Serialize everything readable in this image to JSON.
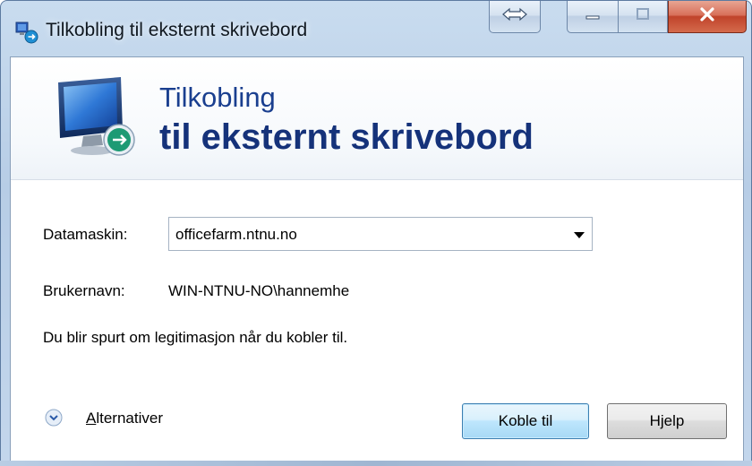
{
  "window": {
    "title": "Tilkobling til eksternt skrivebord"
  },
  "banner": {
    "line1": "Tilkobling",
    "line2": "til eksternt skrivebord"
  },
  "form": {
    "computer_label": "Datamaskin:",
    "computer_value": "officefarm.ntnu.no",
    "username_label": "Brukernavn:",
    "username_value": "WIN-NTNU-NO\\hannemhe",
    "info_text": "Du blir spurt om legitimasjon når du kobler til."
  },
  "footer": {
    "options_label_first": "A",
    "options_label_rest": "lternativer",
    "connect_label": "Koble til",
    "help_label": "Hjelp"
  },
  "colors": {
    "accent": "#1a3f8f",
    "close_button": "#c0432a"
  },
  "icons": {
    "app": "remote-desktop-icon",
    "banner": "monitor-connection-icon",
    "expander": "chevron-down-icon"
  }
}
